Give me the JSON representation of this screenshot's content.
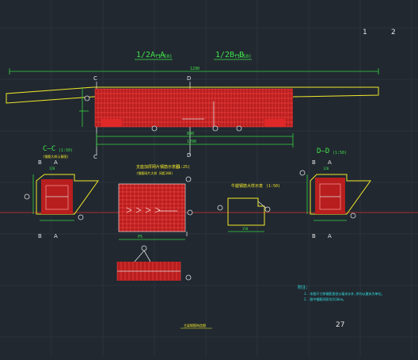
{
  "sheet": {
    "page_numbers": [
      "1",
      "2"
    ],
    "drawing_title": "27",
    "bottom_caption": "主梁钢筋构造图"
  },
  "main_section": {
    "label_a": "1/2A—A",
    "label_a_scale": "(1:50)",
    "label_b": "1/2B—B",
    "label_b_scale": "(1:50)",
    "top_dim": "1290",
    "cut_left_top": "C",
    "cut_right_top": "D",
    "cut_left_bottom": "C",
    "cut_right_bottom": "D",
    "bottom_dim_1": "800",
    "bottom_dim_2": "1290",
    "rebar_color": "#d42222"
  },
  "section_c": {
    "title": "C—C",
    "scale": "(1:50)",
    "subtitle": "(钢筋大样示意图)",
    "top_labels": [
      "B",
      "A"
    ],
    "bottom_labels": [
      "B",
      "A"
    ],
    "dim_top": "120"
  },
  "section_d": {
    "title": "D—D",
    "scale": "(1:50)",
    "top_labels": [
      "B",
      "A"
    ],
    "bottom_labels": [
      "B",
      "A"
    ],
    "dim_top": "120"
  },
  "mesh_detail": {
    "title": "支座加厚网片钢筋示意图",
    "scale": "(1:25)",
    "subtitle": "(钢筋网片大样 间距100)",
    "dim_bottom": "P5"
  },
  "bracket_detail": {
    "title": "牛腿钢筋大样示意",
    "scale": "(1:50)",
    "dim_bottom": "150"
  },
  "notes": {
    "heading": "附注:",
    "lines": [
      "1. 本图尺寸除钢筋直径以毫米计外,余均以厘米为单位。",
      "2. 图中钢筋间距均为10cm。"
    ]
  }
}
